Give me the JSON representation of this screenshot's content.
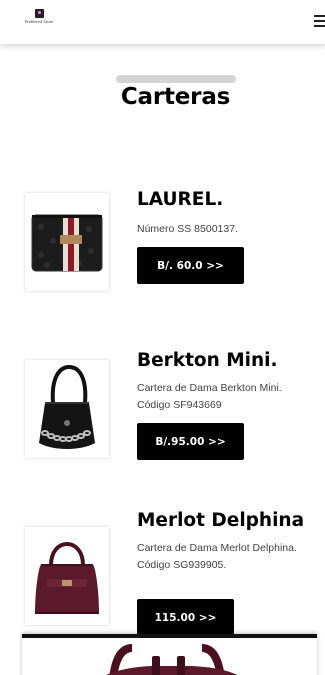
{
  "header": {
    "logo_text": "Preferred Store",
    "menu_icon": "hamburger-menu-icon"
  },
  "section": {
    "title": "Carteras"
  },
  "products": [
    {
      "name": "LAUREL.",
      "desc_lines": [
        "Número SS 8500137."
      ],
      "price_label": "B/. 60.0 >>",
      "icon": "wallet-image"
    },
    {
      "name": "Berkton Mini.",
      "desc_lines": [
        "Cartera de Dama Berkton Mini.",
        "Código SF943669"
      ],
      "price_label": "B/.95.00 >>",
      "icon": "shoulder-bag-image"
    },
    {
      "name": "Merlot Delphina",
      "desc_lines": [
        "Cartera de Dama Merlot Delphina.",
        "Código SG939905."
      ],
      "price_label": "115.00 >>",
      "icon": "handbag-image"
    }
  ],
  "colors": {
    "button_bg": "#000000",
    "button_text": "#ffffff",
    "title_bar": "#d4d4d4",
    "bag_burgundy": "#5a1a2c"
  }
}
